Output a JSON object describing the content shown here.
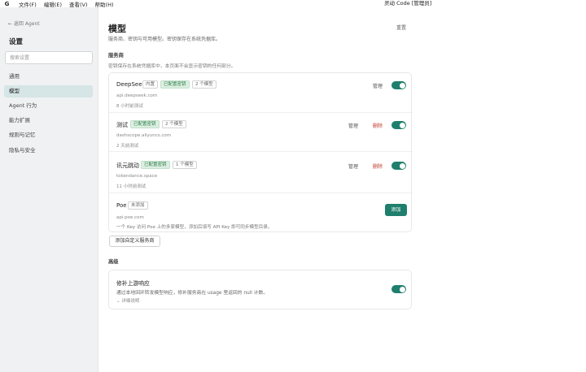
{
  "menubar": {
    "logo": "G",
    "items": [
      "文件(F)",
      "编辑(E)",
      "查看(V)",
      "帮助(H)"
    ],
    "window_title": "灵动 Code [管理员]"
  },
  "sidebar": {
    "back_label": "← 返回 Agent",
    "title": "设置",
    "search_placeholder": "搜索设置",
    "items": [
      "通用",
      "模型",
      "Agent 行为",
      "能力扩展",
      "规则与记忆",
      "隐私与安全"
    ]
  },
  "page": {
    "title": "模型",
    "subtitle": "服务商、密钥与可用模型。密钥保存在系统凭据库。",
    "reset_label": "重置"
  },
  "providers_section": {
    "title": "服务商",
    "note": "密钥保存在系统凭据库中，本页面不会显示密钥的任何部分。",
    "providers": [
      {
        "name": "DeepSeek",
        "tags": [
          "内置",
          "已配置密钥",
          "2 个模型"
        ],
        "url": "api.deepseek.com",
        "status": "8 小时前测试",
        "manage": "管理",
        "delete": "",
        "enabled": true
      },
      {
        "name": "测试",
        "tags": [
          "已配置密钥",
          "2 个模型"
        ],
        "url": "dashscope.aliyuncs.com",
        "status": "2 天前测试",
        "manage": "管理",
        "delete": "删除",
        "enabled": true
      },
      {
        "name": "讯元跳动",
        "tags": [
          "已配置密钥",
          "1 个模型"
        ],
        "url": "tokendance.space",
        "status": "11 小时前测试",
        "manage": "管理",
        "delete": "删除",
        "enabled": true
      },
      {
        "name": "Poe",
        "tags": [
          "未添加"
        ],
        "url": "api.poe.com",
        "description": "一个 Key 访问 Poe 上的多家模型，添加后填写 API Key 即可同步模型目录。",
        "add_label": "添加"
      }
    ],
    "custom_button": "添加自定义服务商"
  },
  "advanced_section": {
    "title": "高级",
    "item": {
      "name": "修补上游响应",
      "description": "通过本地回环转发模型响应，修补服务商在 usage 里返回的 null 计数。",
      "more": "⌄ 详细说明",
      "enabled": true
    }
  }
}
